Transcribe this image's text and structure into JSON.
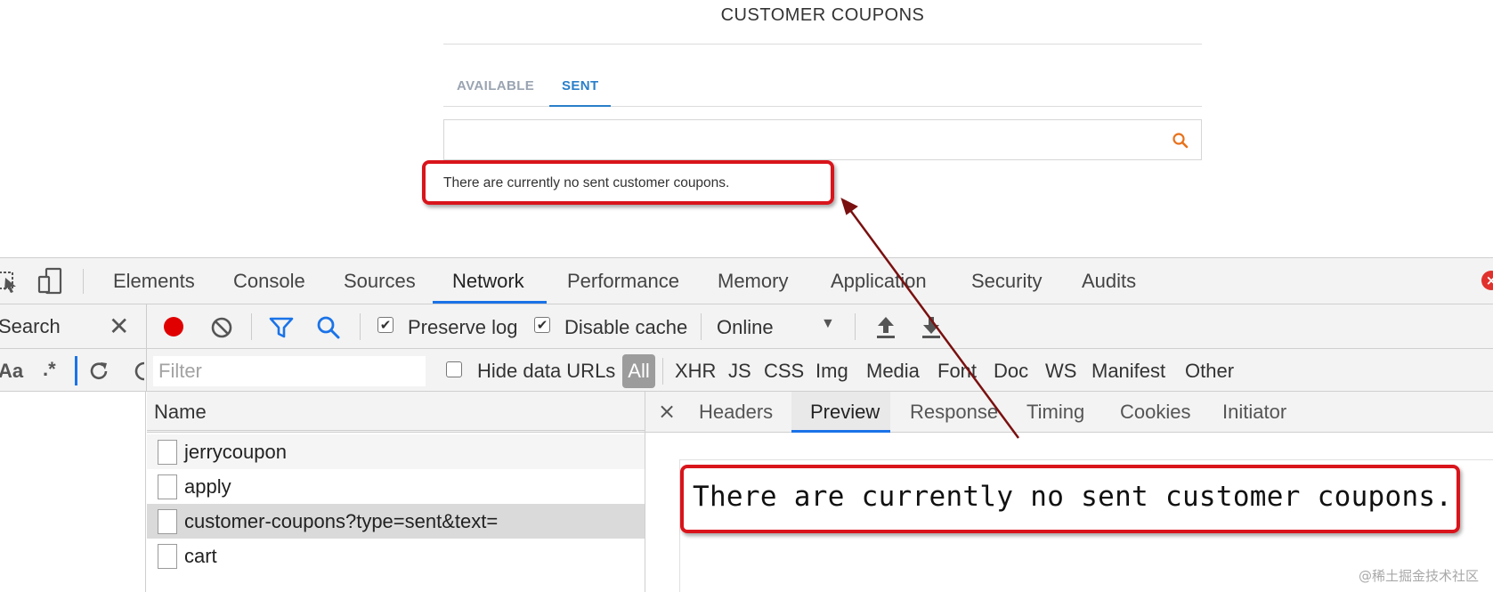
{
  "page": {
    "title": "CUSTOMER COUPONS",
    "tabs": [
      "AVAILABLE",
      "SENT"
    ],
    "active_tab": "SENT",
    "search_placeholder": "",
    "empty_message": "There are currently no sent customer coupons."
  },
  "devtools": {
    "panel_tabs": [
      "Elements",
      "Console",
      "Sources",
      "Network",
      "Performance",
      "Memory",
      "Application",
      "Security",
      "Audits"
    ],
    "active_panel": "Network",
    "search_label": "Search",
    "search_options": {
      "case": "Aa",
      "regex": ".*"
    },
    "toolbar": {
      "preserve_log": "Preserve log",
      "preserve_log_checked": true,
      "disable_cache": "Disable cache",
      "disable_cache_checked": true,
      "throttling": "Online"
    },
    "filter": {
      "placeholder": "Filter",
      "hide_data_urls": "Hide data URLs",
      "hide_data_urls_checked": false,
      "types": [
        "All",
        "XHR",
        "JS",
        "CSS",
        "Img",
        "Media",
        "Font",
        "Doc",
        "WS",
        "Manifest",
        "Other"
      ],
      "active_type": "All"
    },
    "requests": {
      "header": "Name",
      "items": [
        "jerrycoupon",
        "apply",
        "customer-coupons?type=sent&text=",
        "cart"
      ],
      "selected": "customer-coupons?type=sent&text="
    },
    "detail_tabs": [
      "Headers",
      "Preview",
      "Response",
      "Timing",
      "Cookies",
      "Initiator"
    ],
    "active_detail_tab": "Preview",
    "preview_text": "There are currently no sent customer coupons."
  },
  "colors": {
    "accent_blue": "#2a7fc9",
    "highlight_red": "#d9141b",
    "record_red": "#e00000",
    "search_orange": "#e8711a"
  },
  "watermark": "@稀土掘金技术社区"
}
